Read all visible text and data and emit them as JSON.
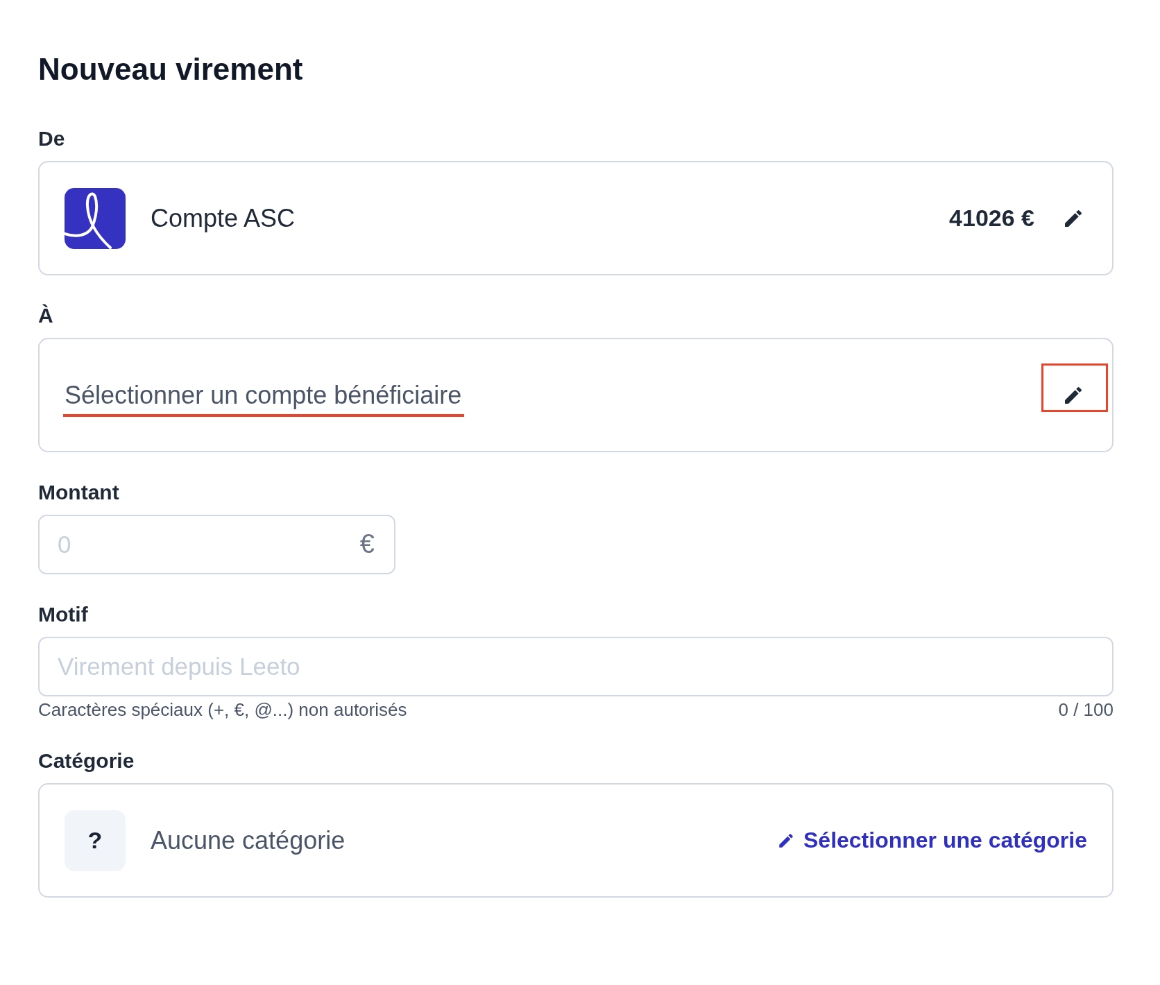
{
  "title": "Nouveau virement",
  "from": {
    "label": "De",
    "account_name": "Compte ASC",
    "balance": "41026 €"
  },
  "to": {
    "label": "À",
    "placeholder": "Sélectionner un compte bénéficiaire",
    "highlighted": true
  },
  "amount": {
    "label": "Montant",
    "placeholder": "0",
    "currency": "€"
  },
  "reason": {
    "label": "Motif",
    "placeholder": "Virement depuis Leeto",
    "hint": "Caractères spéciaux (+, €, @...) non autorisés",
    "counter": "0 / 100"
  },
  "category": {
    "label": "Catégorie",
    "badge": "?",
    "value": "Aucune catégorie",
    "action": "Sélectionner une catégorie"
  }
}
